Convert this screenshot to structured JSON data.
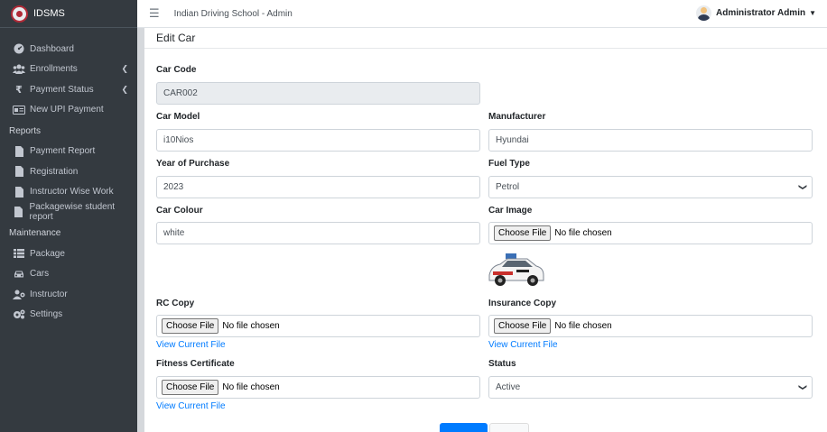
{
  "brand": {
    "name": "IDSMS"
  },
  "topbar": {
    "title": "Indian Driving School - Admin",
    "user_name": "Administrator Admin"
  },
  "sidebar": {
    "main_items": [
      {
        "label": "Dashboard",
        "icon": "dashboard-icon"
      },
      {
        "label": "Enrollments",
        "icon": "users-icon"
      },
      {
        "label": "Payment Status",
        "icon": "rupee-icon"
      },
      {
        "label": "New UPI Payment",
        "icon": "upi-icon"
      }
    ],
    "reports_header": "Reports",
    "report_items": [
      {
        "label": "Payment Report",
        "icon": "file-icon"
      },
      {
        "label": "Registration",
        "icon": "file-icon"
      },
      {
        "label": "Instructor Wise Work",
        "icon": "file-icon"
      },
      {
        "label": "Packagewise student report",
        "icon": "file-icon"
      }
    ],
    "maintenance_header": "Maintenance",
    "maintenance_items": [
      {
        "label": "Package",
        "icon": "list-icon"
      },
      {
        "label": "Cars",
        "icon": "car-icon"
      },
      {
        "label": "Instructor",
        "icon": "instructor-icon"
      },
      {
        "label": "Settings",
        "icon": "gears-icon"
      }
    ]
  },
  "form": {
    "title": "Edit Car",
    "car_code": {
      "label": "Car Code",
      "value": "CAR002"
    },
    "car_model": {
      "label": "Car Model",
      "value": "i10Nios"
    },
    "manufacturer": {
      "label": "Manufacturer",
      "value": "Hyundai"
    },
    "year": {
      "label": "Year of Purchase",
      "value": "2023"
    },
    "fuel": {
      "label": "Fuel Type",
      "value": "Petrol"
    },
    "colour": {
      "label": "Car Colour",
      "value": "white"
    },
    "car_image": {
      "label": "Car Image",
      "button": "Choose File",
      "status": "No file chosen"
    },
    "rc": {
      "label": "RC Copy",
      "button": "Choose File",
      "status": "No file chosen",
      "link": "View Current File"
    },
    "insurance": {
      "label": "Insurance Copy",
      "button": "Choose File",
      "status": "No file chosen",
      "link": "View Current File"
    },
    "fitness": {
      "label": "Fitness Certificate",
      "button": "Choose File",
      "status": "No file chosen",
      "link": "View Current File"
    },
    "status": {
      "label": "Status",
      "value": "Active"
    }
  }
}
